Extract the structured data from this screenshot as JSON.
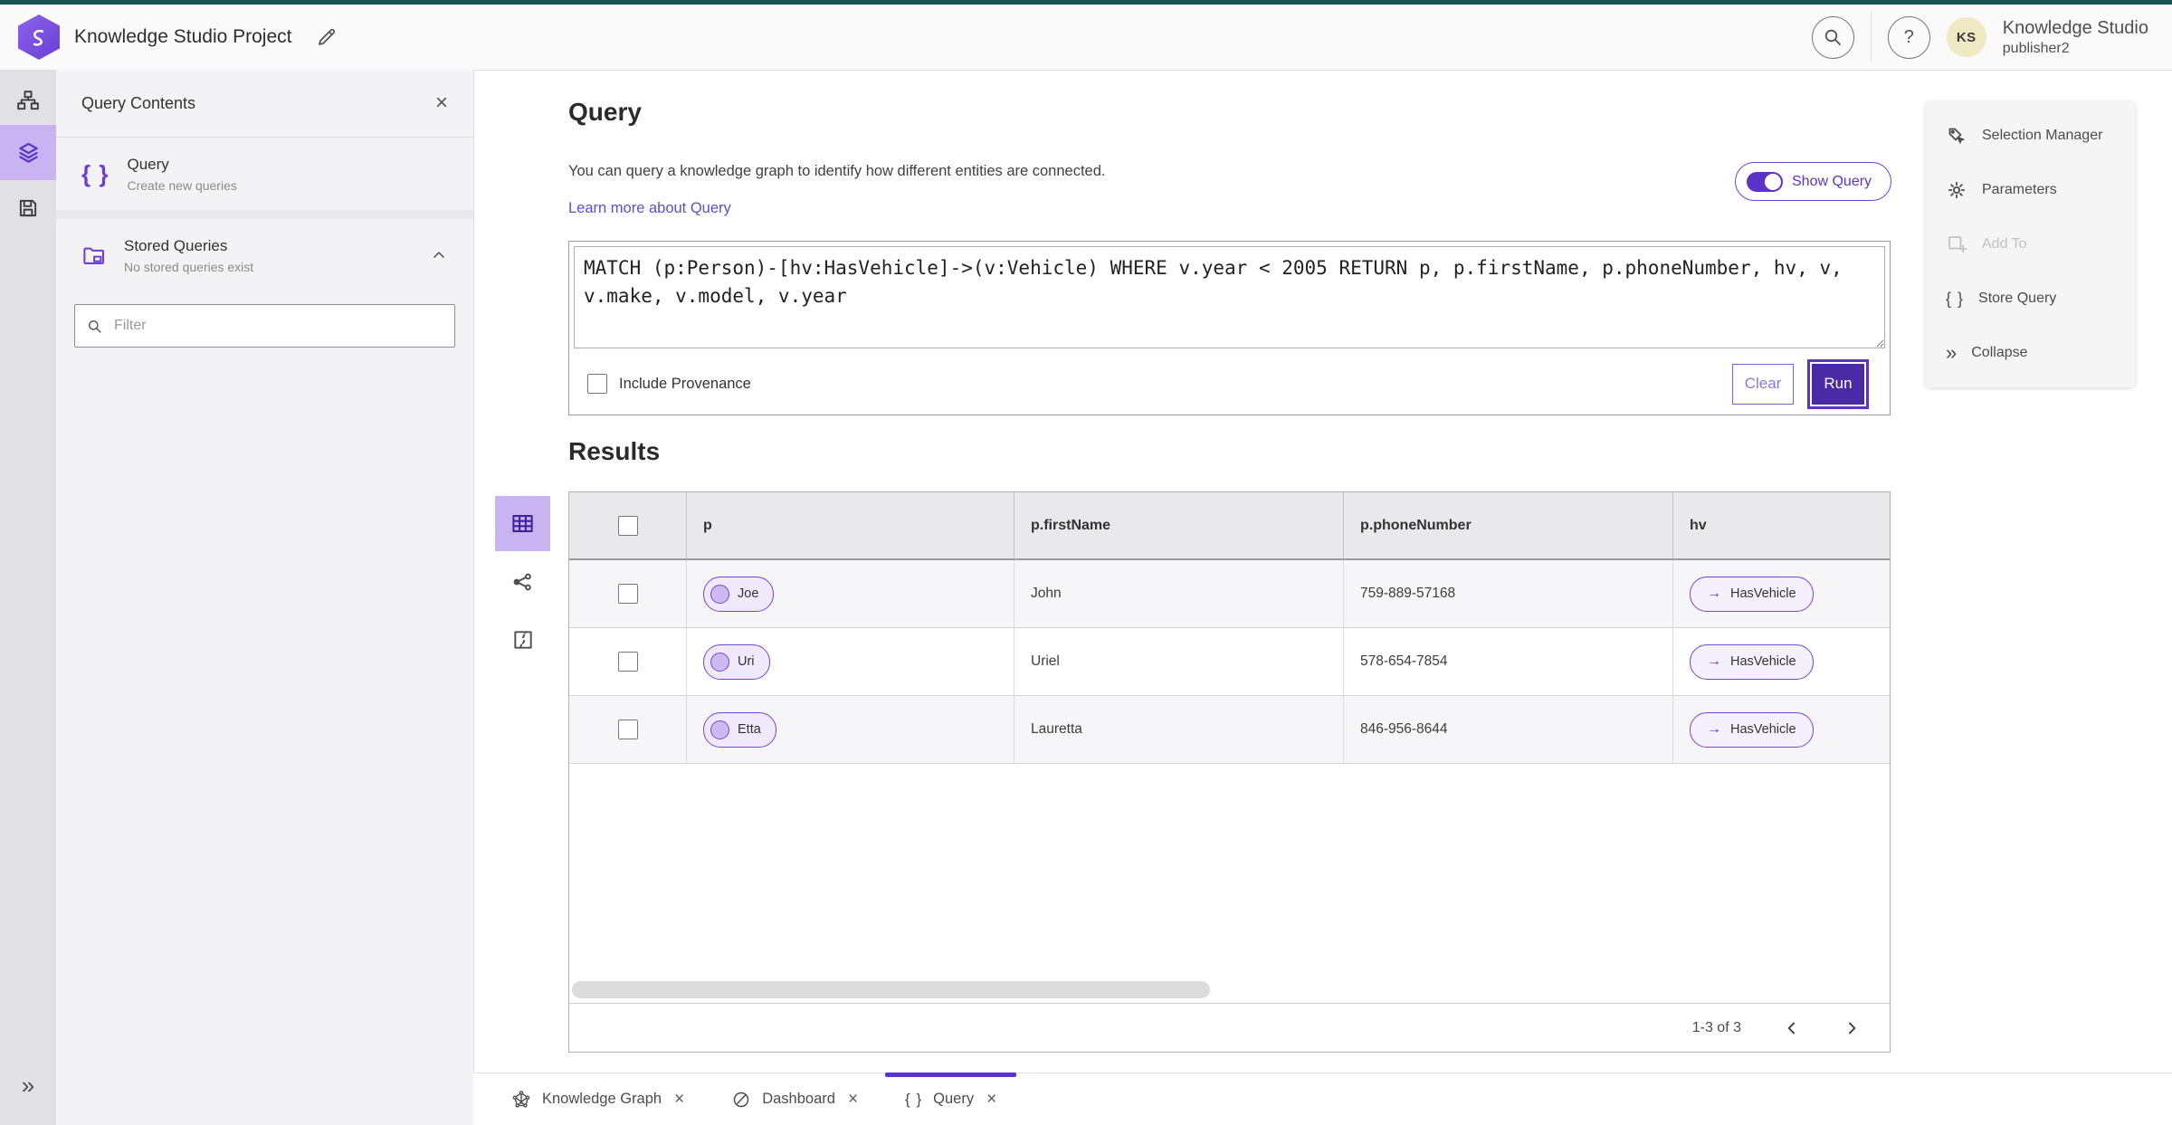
{
  "colors": {
    "top_bar": "#175257",
    "accent": "#5b33c9",
    "accent_dark": "#4b2aa5",
    "accent_light": "#c9b4f2",
    "link": "#5a4fd2"
  },
  "ui": {
    "close_glyph": "×",
    "braces_glyph": "{ }",
    "expand_glyph": "»",
    "arrow_glyph": "→",
    "help_glyph": "?"
  },
  "header": {
    "title": "Knowledge Studio Project",
    "user": {
      "initials": "KS",
      "product": "Knowledge Studio",
      "name": "publisher2"
    }
  },
  "sidebar": {
    "title": "Query Contents",
    "query_item": {
      "title": "Query",
      "subtitle": "Create new queries"
    },
    "stored_item": {
      "title": "Stored Queries",
      "subtitle": "No stored queries exist"
    },
    "filter_placeholder": "Filter"
  },
  "query_panel": {
    "heading": "Query",
    "description": "You can query a knowledge graph to identify how different entities are connected.",
    "learn_more": "Learn more about Query",
    "show_query": "Show Query",
    "query_text": "MATCH (p:Person)-[hv:HasVehicle]->(v:Vehicle) WHERE v.year < 2005 RETURN p, p.firstName, p.phoneNumber, hv, v, v.make, v.model, v.year",
    "include_provenance": "Include Provenance",
    "clear": "Clear",
    "run": "Run"
  },
  "results": {
    "heading": "Results",
    "columns": [
      "p",
      "p.firstName",
      "p.phoneNumber",
      "hv"
    ],
    "rows": [
      {
        "p": "Joe",
        "firstName": "John",
        "phone": "759-889-57168",
        "hv": "HasVehicle"
      },
      {
        "p": "Uri",
        "firstName": "Uriel",
        "phone": "578-654-7854",
        "hv": "HasVehicle"
      },
      {
        "p": "Etta",
        "firstName": "Lauretta",
        "phone": "846-956-8644",
        "hv": "HasVehicle"
      }
    ],
    "pagination": "1-3 of 3"
  },
  "actions_menu": {
    "selection_manager": "Selection Manager",
    "parameters": "Parameters",
    "add_to": "Add To",
    "store_query": "Store Query",
    "collapse": "Collapse"
  },
  "tabs": [
    {
      "label": "Knowledge Graph"
    },
    {
      "label": "Dashboard"
    },
    {
      "label": "Query"
    }
  ]
}
